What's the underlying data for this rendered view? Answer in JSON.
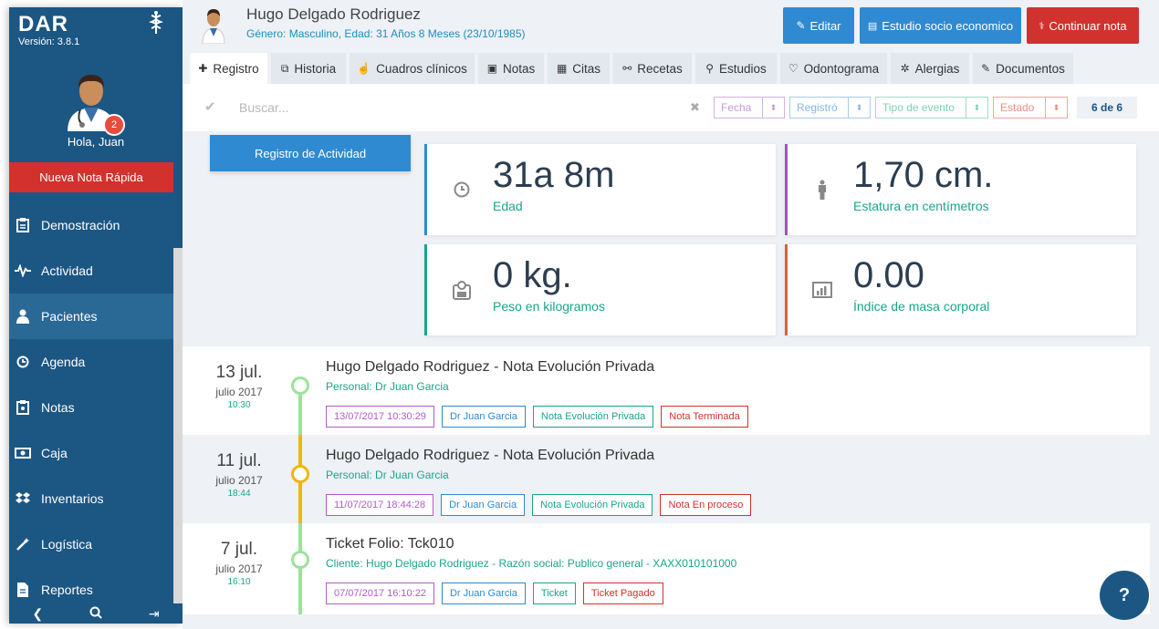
{
  "sidebar": {
    "brand": "DAR",
    "version": "Versión: 3.8.1",
    "badge": "2",
    "greeting": "Hola, Juan",
    "quick_note": "Nueva Nota Rápida",
    "items": [
      {
        "label": "Demostración",
        "icon": "clipboard-icon"
      },
      {
        "label": "Actividad",
        "icon": "pulse-icon"
      },
      {
        "label": "Pacientes",
        "icon": "user-icon"
      },
      {
        "label": "Agenda",
        "icon": "clock-icon"
      },
      {
        "label": "Notas",
        "icon": "clipboard-icon"
      },
      {
        "label": "Caja",
        "icon": "money-icon"
      },
      {
        "label": "Inventarios",
        "icon": "dropbox-icon"
      },
      {
        "label": "Logística",
        "icon": "wand-icon"
      },
      {
        "label": "Reportes",
        "icon": "file-icon"
      }
    ],
    "active_index": 2
  },
  "header": {
    "patient_name": "Hugo Delgado Rodriguez",
    "patient_info": "Género: Masculino, Edad: 31 Años 8 Meses (23/10/1985)",
    "edit": "Editar",
    "study": "Estudio socio economico",
    "continue": "Continuar nota"
  },
  "tabs": [
    {
      "label": "Registro",
      "icon": "✚"
    },
    {
      "label": "Historia",
      "icon": "⧉"
    },
    {
      "label": "Cuadros clínicos",
      "icon": "☝"
    },
    {
      "label": "Notas",
      "icon": "▣"
    },
    {
      "label": "Citas",
      "icon": "▦"
    },
    {
      "label": "Recetas",
      "icon": "⚯"
    },
    {
      "label": "Estudios",
      "icon": "⚲"
    },
    {
      "label": "Odontograma",
      "icon": "♡"
    },
    {
      "label": "Alergias",
      "icon": "✲"
    },
    {
      "label": "Documentos",
      "icon": "✎"
    }
  ],
  "filter": {
    "placeholder": "Buscar...",
    "fecha": "Fecha",
    "registro": "Registró",
    "tipo": "Tipo de evento",
    "estado": "Estado",
    "count": "6 de 6"
  },
  "activity_button": "Registro de Actividad",
  "stats": [
    {
      "value": "31a 8m",
      "label": "Edad",
      "icon": "clock-icon",
      "color": "#2f8ad1"
    },
    {
      "value": "1,70 cm.",
      "label": "Estatura en centímetros",
      "icon": "person-icon",
      "color": "#9b59b6"
    },
    {
      "value": "0 kg.",
      "label": "Peso en kilogramos",
      "icon": "scale-icon",
      "color": "#18a68b"
    },
    {
      "value": "0.00",
      "label": "Índice de masa corporal",
      "icon": "bar-chart-icon",
      "color": "#e05d3d"
    }
  ],
  "timeline": [
    {
      "day": "13 jul.",
      "month": "julio 2017",
      "time": "10:30",
      "title": "Hugo Delgado Rodriguez - Nota Evolución Privada",
      "subtitle": "Personal: Dr Juan Garcia",
      "dot_color": "#9be29b",
      "tags": [
        "13/07/2017 10:30:29",
        "Dr Juan Garcia",
        "Nota Evolución Privada",
        "Nota Terminada"
      ]
    },
    {
      "day": "11 jul.",
      "month": "julio 2017",
      "time": "18:44",
      "title": "Hugo Delgado Rodriguez - Nota Evolución Privada",
      "subtitle": "Personal: Dr Juan Garcia",
      "dot_color": "#f2b705",
      "tags": [
        "11/07/2017 18:44:28",
        "Dr Juan Garcia",
        "Nota Evolución Privada",
        "Nota En proceso"
      ]
    },
    {
      "day": "7 jul.",
      "month": "julio 2017",
      "time": "16:10",
      "title": "Ticket Folio: Tck010",
      "subtitle": "Cliente: Hugo Delgado Rodriguez - Razón social: Publico general - XAXX010101000",
      "dot_color": "#9be29b",
      "tags": [
        "07/07/2017 16:10:22",
        "Dr Juan Garcia",
        "Ticket",
        "Ticket Pagado"
      ]
    }
  ],
  "tag_colors": [
    "#b05cc8",
    "#2f8ad1",
    "#18a68b",
    "#d2322d"
  ],
  "help": "?"
}
